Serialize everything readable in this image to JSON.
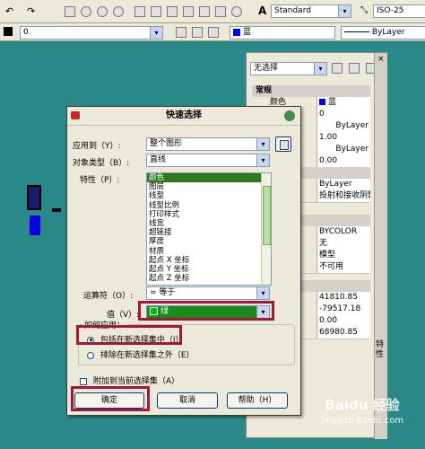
{
  "toolbar": {
    "text_style": "Standard",
    "dim_style": "ISO-25",
    "layer": "0",
    "color": "蓝",
    "linetype": "ByLayer"
  },
  "palette": {
    "selection": "无选择",
    "side_title": "特性",
    "sections": {
      "general": "常规"
    },
    "rows": [
      {
        "name": "颜色",
        "value": "蓝"
      },
      {
        "name": "",
        "value": "0"
      },
      {
        "name": "",
        "value": "ByLayer"
      },
      {
        "name": "",
        "value": "1.00"
      },
      {
        "name": "",
        "value": "ByLayer"
      },
      {
        "name": "",
        "value": "0.00"
      },
      {
        "name": "",
        "value": ""
      },
      {
        "name": "",
        "value": "ByLayer"
      },
      {
        "name": "",
        "value": "投射和接收阴影"
      },
      {
        "name": "",
        "value": ""
      },
      {
        "name": "",
        "value": "BYCOLOR"
      },
      {
        "name": "",
        "value": "无"
      },
      {
        "name": "",
        "value": "模型"
      },
      {
        "name": "",
        "value": "不可用"
      },
      {
        "name": "",
        "value": ""
      },
      {
        "name": "",
        "value": "41810.85"
      },
      {
        "name": "",
        "value": "-79517.18"
      },
      {
        "name": "",
        "value": "0.00"
      },
      {
        "name": "",
        "value": "68980.85"
      }
    ]
  },
  "dialog": {
    "title": "快速选择",
    "apply_to_label": "应用到（Y）:",
    "apply_to_value": "整个图形",
    "object_type_label": "对象类型（B）:",
    "object_type_value": "直线",
    "properties_label": "特性（P）:",
    "properties": [
      "颜色",
      "图层",
      "线型",
      "线型比例",
      "打印样式",
      "线宽",
      "超链接",
      "厚度",
      "材质",
      "起点 X 坐标",
      "起点 Y 坐标",
      "起点 Z 坐标"
    ],
    "operator_label": "运算符（O）:",
    "operator_value": "= 等于",
    "value_label": "值（V）:",
    "value_value": "绿",
    "how_apply_label": "如何应用：",
    "include_label": "包括在新选择集中（I）",
    "exclude_label": "排除在新选择集之外（E）",
    "append_label": "附加到当前选择集（A）",
    "ok_label": "确定",
    "cancel_label": "取消",
    "help_label": "帮助（H）"
  },
  "watermark": {
    "line1": "Baidu 经验",
    "line2": "jingyan.baidu.com"
  },
  "colors": {
    "canvas": "#2a8888",
    "highlight": "#a3173a",
    "selected": "#1f3f9f",
    "green": "#00c000",
    "blue": "#0000e0"
  }
}
